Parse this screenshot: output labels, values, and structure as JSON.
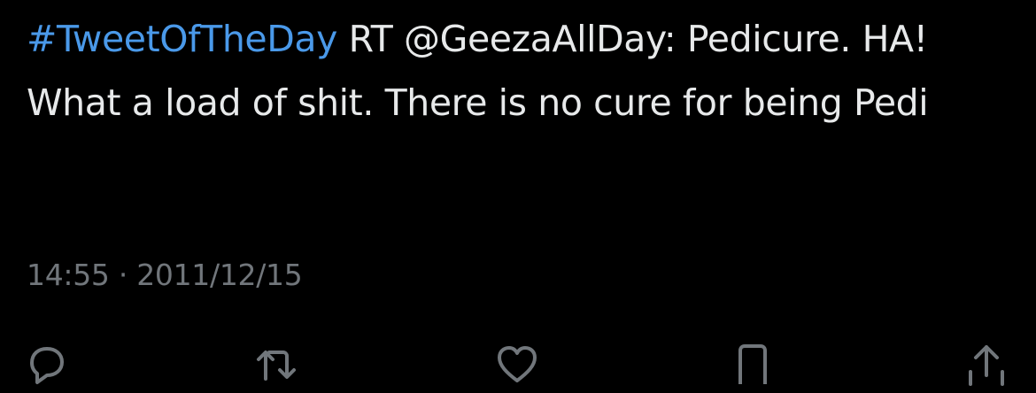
{
  "tweet": {
    "hashtag": "#TweetOfTheDay",
    "body_text": " RT @GeezaAllDay: Pedicure. HA! What a load of shit. There is no cure for being Pedi",
    "time": "14:55",
    "separator": "·",
    "date": "2011/12/15"
  },
  "actions": {
    "reply_icon": "speech-bubble",
    "retweet_icon": "retweet-arrows",
    "like_icon": "heart",
    "bookmark_icon": "bookmark",
    "share_icon": "share-arrow-up"
  },
  "colors": {
    "background": "#000000",
    "text": "#e7e9ea",
    "link": "#4a99e9",
    "muted": "#71767b"
  }
}
